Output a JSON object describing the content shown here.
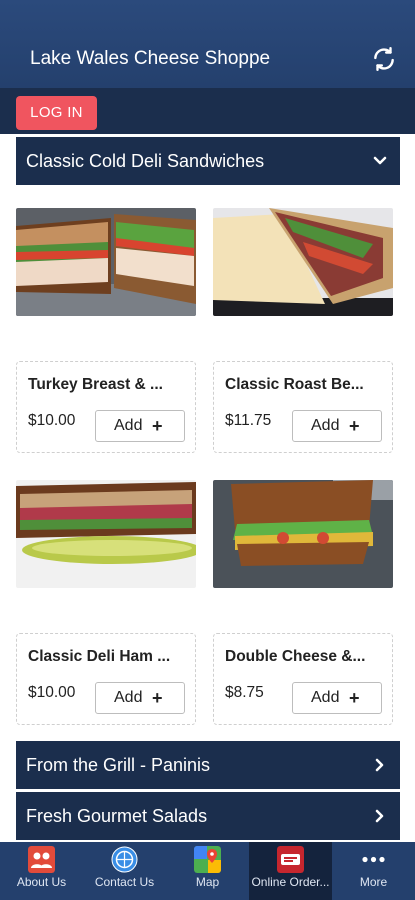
{
  "app": {
    "title": "Lake Wales Cheese Shoppe"
  },
  "login": {
    "label": "LOG IN"
  },
  "categories": [
    {
      "label": "Classic Cold Deli Sandwiches",
      "state": "expanded"
    },
    {
      "label": "From the Grill - Paninis",
      "state": "collapsed"
    },
    {
      "label": "Fresh Gourmet Salads",
      "state": "collapsed"
    }
  ],
  "products": [
    {
      "name": "Turkey Breast & ...",
      "price": "$10.00",
      "add_label": "Add"
    },
    {
      "name": "Classic Roast Be...",
      "price": "$11.75",
      "add_label": "Add"
    },
    {
      "name": "Classic Deli Ham ...",
      "price": "$10.00",
      "add_label": "Add"
    },
    {
      "name": "Double Cheese &...",
      "price": "$8.75",
      "add_label": "Add"
    }
  ],
  "tabs": [
    {
      "label": "About Us",
      "icon": "people-icon"
    },
    {
      "label": "Contact Us",
      "icon": "globe-icon"
    },
    {
      "label": "Map",
      "icon": "map-icon"
    },
    {
      "label": "Online Order...",
      "icon": "order-icon",
      "active": true
    },
    {
      "label": "More",
      "icon": "more-dots-icon"
    }
  ],
  "colors": {
    "header": "#2b4a7c",
    "navy": "#1b2e4d",
    "login": "#f0555f",
    "active_tab": "#14233d"
  }
}
